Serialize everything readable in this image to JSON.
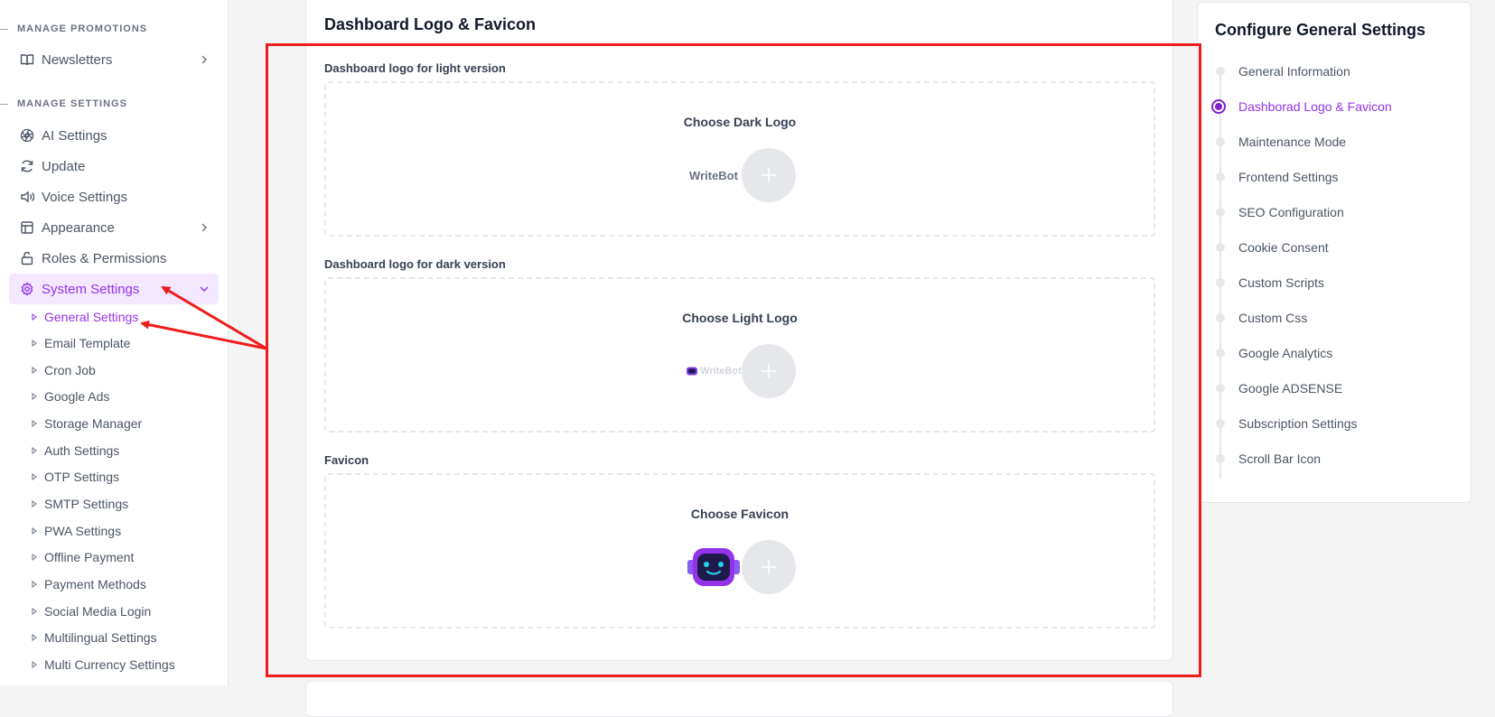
{
  "sidebar": {
    "section_promotions": "MANAGE PROMOTIONS",
    "newsletters": "Newsletters",
    "section_settings": "MANAGE SETTINGS",
    "ai_settings": "AI Settings",
    "update": "Update",
    "voice_settings": "Voice Settings",
    "appearance": "Appearance",
    "roles_permissions": "Roles & Permissions",
    "system_settings": "System Settings",
    "sub_items": [
      "General Settings",
      "Email Template",
      "Cron Job",
      "Google Ads",
      "Storage Manager",
      "Auth Settings",
      "OTP Settings",
      "SMTP Settings",
      "PWA Settings",
      "Offline Payment",
      "Payment Methods",
      "Social Media Login",
      "Multilingual Settings",
      "Multi Currency Settings"
    ],
    "active_sub_item": "General Settings"
  },
  "main": {
    "title": "Dashboard Logo & Favicon",
    "fields": [
      {
        "label": "Dashboard logo for light version",
        "choose": "Choose Dark Logo",
        "preview_text": "WriteBot"
      },
      {
        "label": "Dashboard logo for dark version",
        "choose": "Choose Light Logo",
        "preview_text": "WriteBot"
      },
      {
        "label": "Favicon",
        "choose": "Choose Favicon"
      }
    ]
  },
  "right_panel": {
    "title": "Configure General Settings",
    "steps": [
      "General Information",
      "Dashborad Logo & Favicon",
      "Maintenance Mode",
      "Frontend Settings",
      "SEO Configuration",
      "Cookie Consent",
      "Custom Scripts",
      "Custom Css",
      "Google Analytics",
      "Google ADSENSE",
      "Subscription Settings",
      "Scroll Bar Icon"
    ],
    "active_step": "Dashborad Logo & Favicon"
  },
  "colors": {
    "accent": "#9333ea",
    "accent_bg": "#f3e8ff",
    "annotation_red": "#ef1c1c"
  }
}
